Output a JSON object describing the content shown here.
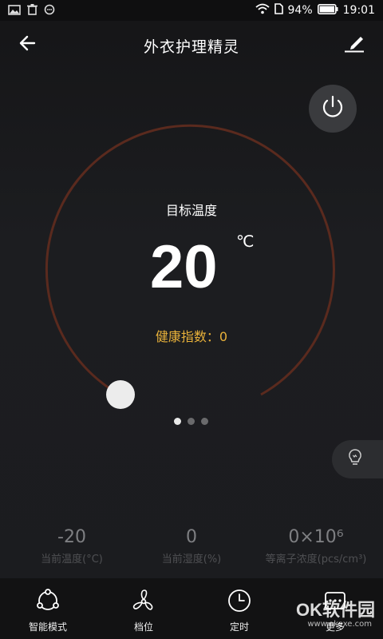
{
  "status_bar": {
    "battery": "94%",
    "time": "19:01"
  },
  "header": {
    "title": "外衣护理精灵"
  },
  "dial": {
    "target_label": "目标温度",
    "target_value": "20",
    "unit": "℃",
    "health_label": "健康指数：0",
    "page_count": 3,
    "active_page": 0
  },
  "stats": [
    {
      "value": "-20",
      "label": "当前温度(°C)"
    },
    {
      "value": "0",
      "label": "当前湿度(%)"
    },
    {
      "value": "0×10⁶",
      "label": "等离子浓度(pcs/cm³)"
    }
  ],
  "bottom_nav": [
    {
      "label": "智能模式",
      "icon": "smart-mode-icon"
    },
    {
      "label": "档位",
      "icon": "fan-icon"
    },
    {
      "label": "定时",
      "icon": "clock-icon"
    },
    {
      "label": "更多",
      "icon": "more-icon"
    }
  ],
  "watermark": {
    "text": "OK软件园",
    "url": "www.okexe.com"
  },
  "colors": {
    "arc": "#5a2a1e",
    "health": "#e8b13a",
    "background": "#1b1b1d"
  }
}
